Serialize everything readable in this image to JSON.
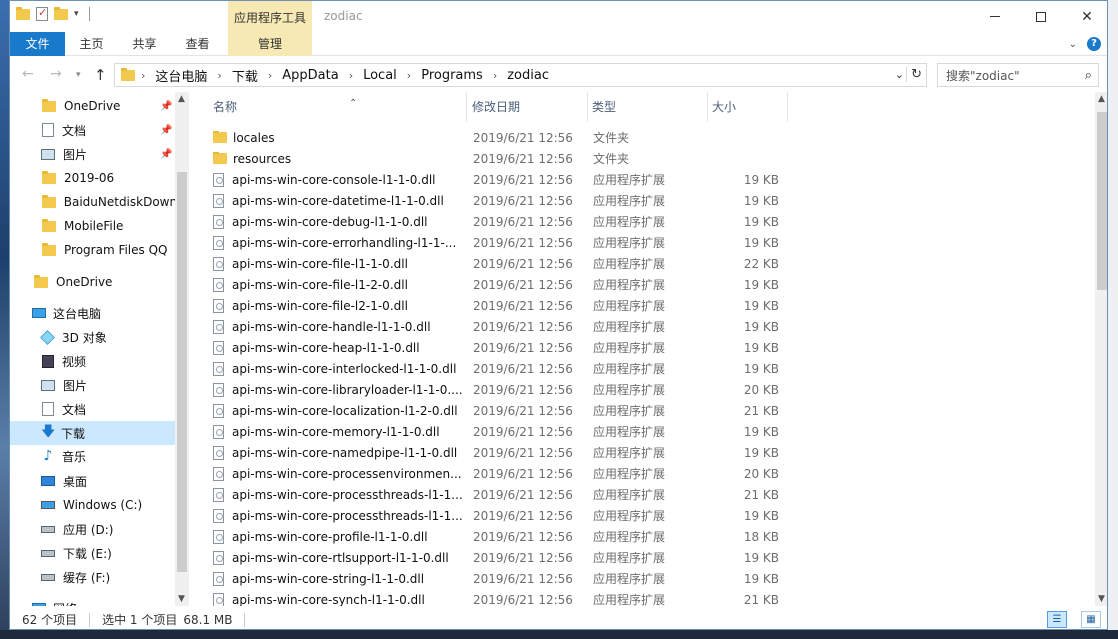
{
  "window": {
    "title": "zodiac",
    "contextual_tab_group": "应用程序工具"
  },
  "ribbon": {
    "tabs": [
      {
        "label": "文件"
      },
      {
        "label": "主页"
      },
      {
        "label": "共享"
      },
      {
        "label": "查看"
      },
      {
        "label": "管理"
      }
    ]
  },
  "address": {
    "crumbs": [
      "这台电脑",
      "下载",
      "AppData",
      "Local",
      "Programs",
      "zodiac"
    ]
  },
  "search": {
    "placeholder": "搜索\"zodiac\""
  },
  "sidebar": {
    "items": [
      {
        "label": "OneDrive",
        "icon": "folder-icon",
        "pinned": true
      },
      {
        "label": "文档",
        "icon": "document-icon",
        "pinned": true
      },
      {
        "label": "图片",
        "icon": "pictures-icon",
        "pinned": true
      },
      {
        "label": "2019-06",
        "icon": "folder-icon",
        "pinned": false
      },
      {
        "label": "BaiduNetdiskDown",
        "icon": "folder-icon",
        "pinned": false
      },
      {
        "label": "MobileFile",
        "icon": "folder-icon",
        "pinned": false
      },
      {
        "label": "Program Files QQ",
        "icon": "folder-icon",
        "pinned": false
      },
      {
        "label": "OneDrive",
        "icon": "folder-icon",
        "pinned": false
      },
      {
        "label": "这台电脑",
        "icon": "computer-icon",
        "pinned": false
      },
      {
        "label": "3D 对象",
        "icon": "3d-objects-icon",
        "pinned": false
      },
      {
        "label": "视频",
        "icon": "video-icon",
        "pinned": false
      },
      {
        "label": "图片",
        "icon": "pictures-icon",
        "pinned": false
      },
      {
        "label": "文档",
        "icon": "document-icon",
        "pinned": false
      },
      {
        "label": "下载",
        "icon": "download-icon",
        "pinned": false,
        "selected": true
      },
      {
        "label": "音乐",
        "icon": "music-icon",
        "pinned": false
      },
      {
        "label": "桌面",
        "icon": "desktop-icon",
        "pinned": false
      },
      {
        "label": "Windows (C:)",
        "icon": "windows-drive-icon",
        "pinned": false
      },
      {
        "label": "应用 (D:)",
        "icon": "drive-icon",
        "pinned": false
      },
      {
        "label": "下载 (E:)",
        "icon": "drive-icon",
        "pinned": false
      },
      {
        "label": "缓存 (F:)",
        "icon": "drive-icon",
        "pinned": false
      },
      {
        "label": "网络",
        "icon": "network-icon",
        "pinned": false
      }
    ]
  },
  "columns": {
    "name": "名称",
    "date": "修改日期",
    "type": "类型",
    "size": "大小"
  },
  "files": [
    {
      "name": "locales",
      "date": "2019/6/21 12:56",
      "type": "文件夹",
      "size": "",
      "kind": "folder"
    },
    {
      "name": "resources",
      "date": "2019/6/21 12:56",
      "type": "文件夹",
      "size": "",
      "kind": "folder"
    },
    {
      "name": "api-ms-win-core-console-l1-1-0.dll",
      "date": "2019/6/21 12:56",
      "type": "应用程序扩展",
      "size": "19 KB",
      "kind": "dll"
    },
    {
      "name": "api-ms-win-core-datetime-l1-1-0.dll",
      "date": "2019/6/21 12:56",
      "type": "应用程序扩展",
      "size": "19 KB",
      "kind": "dll"
    },
    {
      "name": "api-ms-win-core-debug-l1-1-0.dll",
      "date": "2019/6/21 12:56",
      "type": "应用程序扩展",
      "size": "19 KB",
      "kind": "dll"
    },
    {
      "name": "api-ms-win-core-errorhandling-l1-1-...",
      "date": "2019/6/21 12:56",
      "type": "应用程序扩展",
      "size": "19 KB",
      "kind": "dll"
    },
    {
      "name": "api-ms-win-core-file-l1-1-0.dll",
      "date": "2019/6/21 12:56",
      "type": "应用程序扩展",
      "size": "22 KB",
      "kind": "dll"
    },
    {
      "name": "api-ms-win-core-file-l1-2-0.dll",
      "date": "2019/6/21 12:56",
      "type": "应用程序扩展",
      "size": "19 KB",
      "kind": "dll"
    },
    {
      "name": "api-ms-win-core-file-l2-1-0.dll",
      "date": "2019/6/21 12:56",
      "type": "应用程序扩展",
      "size": "19 KB",
      "kind": "dll"
    },
    {
      "name": "api-ms-win-core-handle-l1-1-0.dll",
      "date": "2019/6/21 12:56",
      "type": "应用程序扩展",
      "size": "19 KB",
      "kind": "dll"
    },
    {
      "name": "api-ms-win-core-heap-l1-1-0.dll",
      "date": "2019/6/21 12:56",
      "type": "应用程序扩展",
      "size": "19 KB",
      "kind": "dll"
    },
    {
      "name": "api-ms-win-core-interlocked-l1-1-0.dll",
      "date": "2019/6/21 12:56",
      "type": "应用程序扩展",
      "size": "19 KB",
      "kind": "dll"
    },
    {
      "name": "api-ms-win-core-libraryloader-l1-1-0....",
      "date": "2019/6/21 12:56",
      "type": "应用程序扩展",
      "size": "20 KB",
      "kind": "dll"
    },
    {
      "name": "api-ms-win-core-localization-l1-2-0.dll",
      "date": "2019/6/21 12:56",
      "type": "应用程序扩展",
      "size": "21 KB",
      "kind": "dll"
    },
    {
      "name": "api-ms-win-core-memory-l1-1-0.dll",
      "date": "2019/6/21 12:56",
      "type": "应用程序扩展",
      "size": "19 KB",
      "kind": "dll"
    },
    {
      "name": "api-ms-win-core-namedpipe-l1-1-0.dll",
      "date": "2019/6/21 12:56",
      "type": "应用程序扩展",
      "size": "19 KB",
      "kind": "dll"
    },
    {
      "name": "api-ms-win-core-processenvironmen...",
      "date": "2019/6/21 12:56",
      "type": "应用程序扩展",
      "size": "20 KB",
      "kind": "dll"
    },
    {
      "name": "api-ms-win-core-processthreads-l1-1...",
      "date": "2019/6/21 12:56",
      "type": "应用程序扩展",
      "size": "21 KB",
      "kind": "dll"
    },
    {
      "name": "api-ms-win-core-processthreads-l1-1...",
      "date": "2019/6/21 12:56",
      "type": "应用程序扩展",
      "size": "19 KB",
      "kind": "dll"
    },
    {
      "name": "api-ms-win-core-profile-l1-1-0.dll",
      "date": "2019/6/21 12:56",
      "type": "应用程序扩展",
      "size": "18 KB",
      "kind": "dll"
    },
    {
      "name": "api-ms-win-core-rtlsupport-l1-1-0.dll",
      "date": "2019/6/21 12:56",
      "type": "应用程序扩展",
      "size": "19 KB",
      "kind": "dll"
    },
    {
      "name": "api-ms-win-core-string-l1-1-0.dll",
      "date": "2019/6/21 12:56",
      "type": "应用程序扩展",
      "size": "19 KB",
      "kind": "dll"
    },
    {
      "name": "api-ms-win-core-synch-l1-1-0.dll",
      "date": "2019/6/21 12:56",
      "type": "应用程序扩展",
      "size": "21 KB",
      "kind": "dll"
    }
  ],
  "status": {
    "item_count": "62 个项目",
    "selected": "选中 1 个项目",
    "selected_size": "68.1 MB"
  },
  "colors": {
    "accent": "#1979ca",
    "contextual": "#f7e9b4",
    "selection": "#cce8ff"
  }
}
